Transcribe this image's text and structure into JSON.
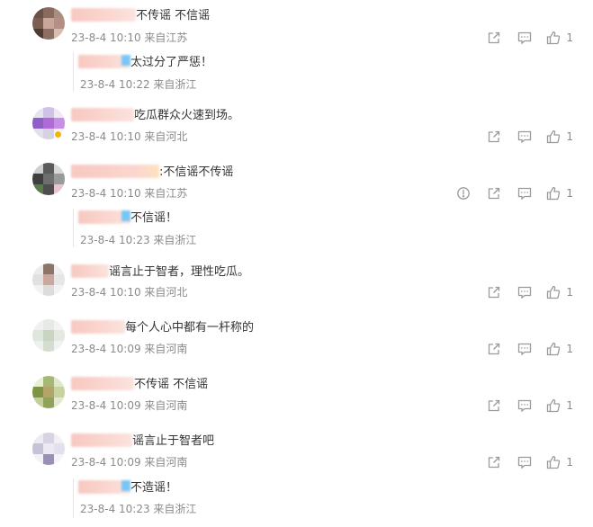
{
  "colors": {
    "meta_text": "#8b8b8b",
    "body_text": "#333333",
    "icon_gray": "#9a9a9a",
    "name_blur": "#f7c8c0",
    "verified_badge": "#f6b400",
    "reply_bar": "#e6e6e6"
  },
  "icons": {
    "report": "alert-circle-icon",
    "share": "share-arrow-icon",
    "reply": "comment-bubble-icon",
    "like": "thumbs-up-icon"
  },
  "comments": [
    {
      "text": "不传谣 不信谣",
      "meta": "23-8-4 10:10 来自江苏",
      "likes": "1",
      "reply": {
        "text": "太过分了严惩！",
        "meta": "23-8-4 10:22 来自浙江"
      }
    },
    {
      "text": "吃瓜群众火速到场。",
      "meta": "23-8-4 10:10 来自河北",
      "likes": "1"
    },
    {
      "text": ":不信谣不传谣",
      "meta": "23-8-4 10:10 来自江苏",
      "likes": "1",
      "reply": {
        "text": "不信谣！",
        "meta": "23-8-4 10:23 来自浙江"
      }
    },
    {
      "text": "谣言止于智者，理性吃瓜。",
      "meta": "23-8-4 10:10 来自河北",
      "likes": "1"
    },
    {
      "text": "每个人心中都有一杆称的",
      "meta": "23-8-4 10:09 来自河南",
      "likes": "1"
    },
    {
      "text": "不传谣 不信谣",
      "meta": "23-8-4 10:09 来自河南",
      "likes": "1"
    },
    {
      "text": "谣言止于智者吧",
      "meta": "23-8-4 10:09 来自河南",
      "likes": "1",
      "reply": {
        "text": "不造谣！",
        "meta": "23-8-4 10:23 来自浙江"
      }
    }
  ]
}
